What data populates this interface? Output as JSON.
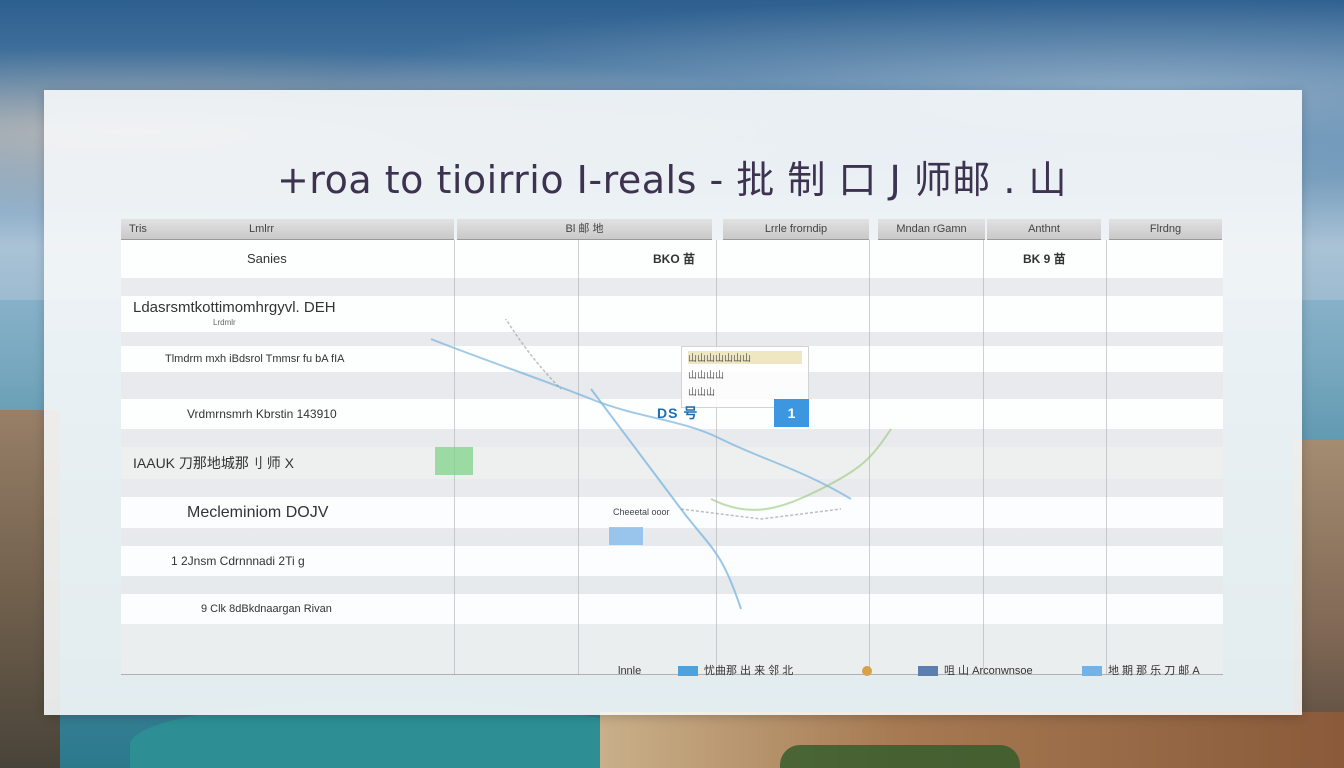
{
  "page": {
    "title": "+roa to tioirrio I-reals - 批 制 口 J 师邮 . 山"
  },
  "table": {
    "headers": [
      "Tris",
      "Lmlrr",
      "Bl 邮 地",
      "Lrrle   frorndip",
      "Mndan rGamn",
      "Anthnt",
      "Flrdng"
    ],
    "rows": [
      {
        "name": "Sanies",
        "c3": "BKO 苗",
        "c6": "BK 9 苗"
      },
      {
        "name": "Ldasrsmtkottimomhrgyvl. DEH",
        "sub": "Lrdmlr"
      },
      {
        "name": "Tlmdrm mxh iBdsrol Tmmsr fu bA fIA"
      },
      {
        "name": "Vrdmrnsmrh Kbrstin 143910"
      },
      {
        "name": "IAAUK 刀那地城那刂 师 X"
      },
      {
        "name": "Mecleminiom DOJV"
      },
      {
        "name": "1 2Jnsm Cdrnnnadi 2Ti g"
      },
      {
        "name": "9 Clk 8dBkdnaargan Rivan"
      }
    ]
  },
  "map": {
    "card_line1": "山山山山山山山",
    "card_line2": "山山山山",
    "card_line3": "山山山",
    "marker_label": "DS 号",
    "badge": "1",
    "town_label": "Cheeetal ooor"
  },
  "legend": {
    "prefix": "lnnle",
    "items": [
      {
        "label": "忧曲那 出 来 邻 北",
        "color": "#4aa3e0"
      },
      {
        "label": "",
        "color": "#d9a04a"
      },
      {
        "label": "咀 山 Arconwnsoe",
        "color": "#5b7fb0"
      },
      {
        "label": "地 期 那 乐 刀 邮 A",
        "color": "#6fb3e8"
      }
    ]
  },
  "colors": {
    "title": "#3d3350",
    "header_bg": "#d4d4d4",
    "accent_blue": "#3d97e0",
    "accent_green": "#78d282"
  }
}
